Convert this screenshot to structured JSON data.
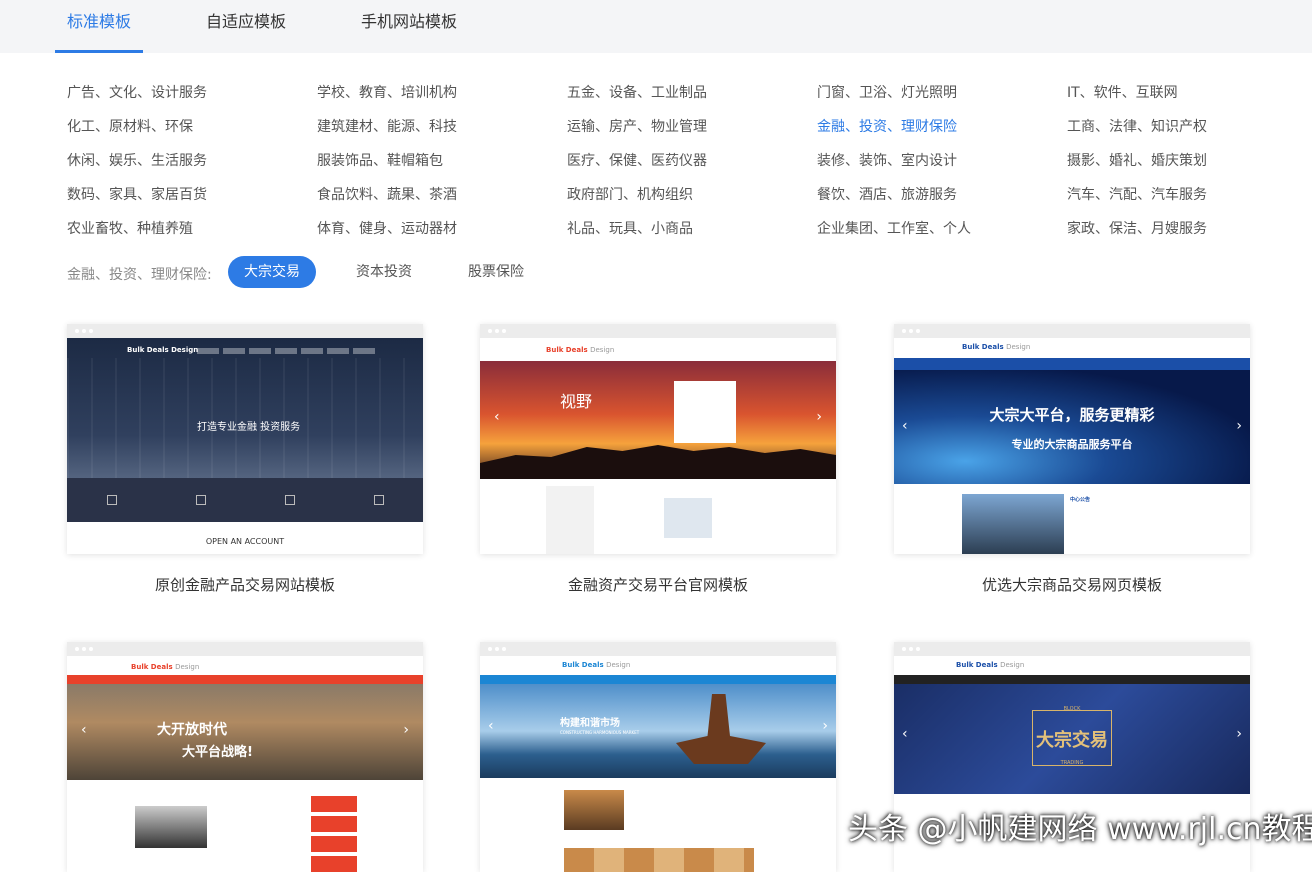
{
  "tabs": [
    "标准模板",
    "自适应模板",
    "手机网站模板"
  ],
  "categories": [
    [
      "广告、文化、设计服务",
      "学校、教育、培训机构",
      "五金、设备、工业制品",
      "门窗、卫浴、灯光照明",
      "IT、软件、互联网"
    ],
    [
      "化工、原材料、环保",
      "建筑建材、能源、科技",
      "运输、房产、物业管理",
      "金融、投资、理财保险",
      "工商、法律、知识产权"
    ],
    [
      "休闲、娱乐、生活服务",
      "服装饰品、鞋帽箱包",
      "医疗、保健、医药仪器",
      "装修、装饰、室内设计",
      "摄影、婚礼、婚庆策划"
    ],
    [
      "数码、家具、家居百货",
      "食品饮料、蔬果、茶酒",
      "政府部门、机构组织",
      "餐饮、酒店、旅游服务",
      "汽车、汽配、汽车服务"
    ],
    [
      "农业畜牧、种植养殖",
      "体育、健身、运动器材",
      "礼品、玩具、小商品",
      "企业集团、工作室、个人",
      "家政、保洁、月嫂服务"
    ]
  ],
  "subfilter": {
    "label": "金融、投资、理财保险:",
    "options": [
      "大宗交易",
      "资本投资",
      "股票保险"
    ]
  },
  "templates": [
    {
      "caption": "原创金融产品交易网站模板",
      "logo": "Bulk Deals Design",
      "headline": "打造专业金融 投资服务",
      "footer": "OPEN AN ACCOUNT"
    },
    {
      "caption": "金融资产交易平台官网模板",
      "logo": "Bulk Deals",
      "logo_suffix": "Design",
      "headline": "视野"
    },
    {
      "caption": "优选大宗商品交易网页模板",
      "logo": "Bulk Deals",
      "logo_suffix": "Design",
      "headline": "大宗大平台，服务更精彩",
      "subheadline": "专业的大宗商品服务平台",
      "panel_title": "中心公告"
    },
    {
      "caption": "",
      "logo": "Bulk Deals",
      "logo_suffix": "Design",
      "headline": "大开放时代",
      "subheadline": "大平台战略!"
    },
    {
      "caption": "",
      "logo": "Bulk Deals",
      "logo_suffix": "Design",
      "headline": "构建和谐市场",
      "subheadline": "CONSTRUCTING HARMONIOUS MARKET"
    },
    {
      "caption": "",
      "logo": "Bulk Deals",
      "logo_suffix": "Design",
      "headline": "大宗交易",
      "badge_top": "BLOCK",
      "badge_bottom": "TRADING"
    }
  ],
  "watermark": "头条 @小帆建网络 www.rjl.cn教程网",
  "colors": {
    "accent": "#2d7be5",
    "brand_red": "#e8412b",
    "nav_blue": "#1b4fa8"
  }
}
